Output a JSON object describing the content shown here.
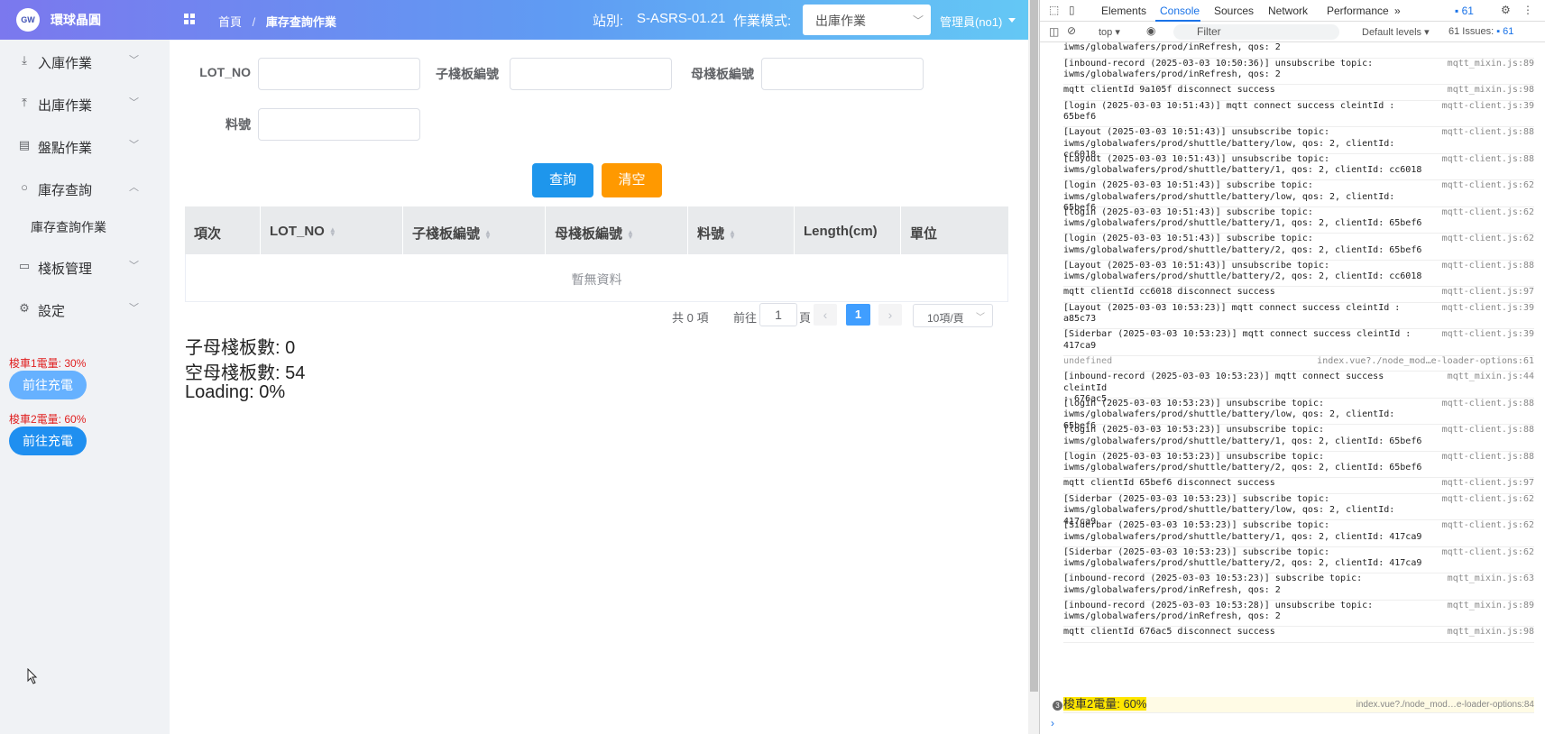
{
  "header": {
    "logo_text": "GW",
    "brand": "環球晶圓",
    "breadcrumb_home": "首頁",
    "breadcrumb_sep": "/",
    "breadcrumb_current": "庫存查詢作業",
    "station_label": "站別:",
    "station_value": "S-ASRS-01.21",
    "mode_label": "作業模式:",
    "mode_value": "出庫作業",
    "user": "管理員(no1)"
  },
  "sidebar": {
    "items": [
      {
        "label": "入庫作業",
        "icon": "download-icon"
      },
      {
        "label": "出庫作業",
        "icon": "upload-icon"
      },
      {
        "label": "盤點作業",
        "icon": "document-icon"
      },
      {
        "label": "庫存查詢",
        "icon": "search-icon"
      },
      {
        "label": "棧板管理",
        "icon": "card-icon"
      },
      {
        "label": "設定",
        "icon": "gear-icon"
      }
    ],
    "sub_item": "庫存查詢作業",
    "battery1": "梭車1電量: 30%",
    "battery2": "梭車2電量: 60%",
    "charge_button": "前往充電"
  },
  "form": {
    "lot_no": "LOT_NO",
    "child_pallet": "子棧板編號",
    "parent_pallet": "母棧板編號",
    "part_no": "料號",
    "query_button": "查詢",
    "clear_button": "清空"
  },
  "table": {
    "columns": [
      "項次",
      "LOT_NO",
      "子棧板編號",
      "母棧板編號",
      "料號",
      "Length(cm)",
      "單位"
    ],
    "empty_text": "暫無資料"
  },
  "pagination": {
    "total": "共 0 項",
    "goto_label": "前往",
    "goto_value": "1",
    "page_unit": "頁",
    "current_page": "1",
    "page_size": "10項/頁"
  },
  "stats": {
    "child_parent": "子母棧板數: 0",
    "empty_parent": "空母棧板數: 54",
    "loading": "Loading: 0%"
  },
  "devtools": {
    "tabs": [
      "Elements",
      "Console",
      "Sources",
      "Network",
      "Performance"
    ],
    "more": "»",
    "issue_count": "61",
    "context": "top",
    "filter_placeholder": "Filter",
    "levels": "Default levels",
    "issues": "61 Issues:",
    "issues_count2": "61",
    "logs": [
      {
        "msg": "iwms/globalwafers/prod/inRefresh, qos: 2",
        "src": ""
      },
      {
        "msg": "[inbound-record (2025-03-03 10:50:36)] unsubscribe topic:\niwms/globalwafers/prod/inRefresh, qos: 2",
        "src": "mqtt_mixin.js:89"
      },
      {
        "msg": "mqtt clientId 9a105f disconnect success",
        "src": "mqtt_mixin.js:98"
      },
      {
        "msg": "[login (2025-03-03 10:51:43)] mqtt connect success cleintId :\n65bef6",
        "src": "mqtt-client.js:39"
      },
      {
        "msg": "[Layout (2025-03-03 10:51:43)] unsubscribe topic:\niwms/globalwafers/prod/shuttle/battery/low, qos: 2, clientId: cc6018",
        "src": "mqtt-client.js:88"
      },
      {
        "msg": "[Layout (2025-03-03 10:51:43)] unsubscribe topic:\niwms/globalwafers/prod/shuttle/battery/1, qos: 2, clientId: cc6018",
        "src": "mqtt-client.js:88"
      },
      {
        "msg": "[login (2025-03-03 10:51:43)] subscribe topic:\niwms/globalwafers/prod/shuttle/battery/low, qos: 2, clientId: 65bef6",
        "src": "mqtt-client.js:62"
      },
      {
        "msg": "[login (2025-03-03 10:51:43)] subscribe topic:\niwms/globalwafers/prod/shuttle/battery/1, qos: 2, clientId: 65bef6",
        "src": "mqtt-client.js:62"
      },
      {
        "msg": "[login (2025-03-03 10:51:43)] subscribe topic:\niwms/globalwafers/prod/shuttle/battery/2, qos: 2, clientId: 65bef6",
        "src": "mqtt-client.js:62"
      },
      {
        "msg": "[Layout (2025-03-03 10:51:43)] unsubscribe topic:\niwms/globalwafers/prod/shuttle/battery/2, qos: 2, clientId: cc6018",
        "src": "mqtt-client.js:88"
      },
      {
        "msg": "mqtt clientId cc6018 disconnect success",
        "src": "mqtt-client.js:97"
      },
      {
        "msg": "[Layout (2025-03-03 10:53:23)] mqtt connect success cleintId :\na85c73",
        "src": "mqtt-client.js:39"
      },
      {
        "msg": "[Siderbar (2025-03-03 10:53:23)] mqtt connect success cleintId :\n417ca9",
        "src": "mqtt-client.js:39"
      },
      {
        "msg": "undefined",
        "src": "index.vue?./node_mod…e-loader-options:61",
        "muted": true
      },
      {
        "msg": "[inbound-record (2025-03-03 10:53:23)] mqtt connect success cleintId\n: 676ac5",
        "src": "mqtt_mixin.js:44"
      },
      {
        "msg": "[login (2025-03-03 10:53:23)] unsubscribe topic:\niwms/globalwafers/prod/shuttle/battery/low, qos: 2, clientId: 65bef6",
        "src": "mqtt-client.js:88"
      },
      {
        "msg": "[login (2025-03-03 10:53:23)] unsubscribe topic:\niwms/globalwafers/prod/shuttle/battery/1, qos: 2, clientId: 65bef6",
        "src": "mqtt-client.js:88"
      },
      {
        "msg": "[login (2025-03-03 10:53:23)] unsubscribe topic:\niwms/globalwafers/prod/shuttle/battery/2, qos: 2, clientId: 65bef6",
        "src": "mqtt-client.js:88"
      },
      {
        "msg": "mqtt clientId 65bef6 disconnect success",
        "src": "mqtt-client.js:97"
      },
      {
        "msg": "[Siderbar (2025-03-03 10:53:23)] subscribe topic:\niwms/globalwafers/prod/shuttle/battery/low, qos: 2, clientId: 417ca9",
        "src": "mqtt-client.js:62"
      },
      {
        "msg": "[Siderbar (2025-03-03 10:53:23)] subscribe topic:\niwms/globalwafers/prod/shuttle/battery/1, qos: 2, clientId: 417ca9",
        "src": "mqtt-client.js:62"
      },
      {
        "msg": "[Siderbar (2025-03-03 10:53:23)] subscribe topic:\niwms/globalwafers/prod/shuttle/battery/2, qos: 2, clientId: 417ca9",
        "src": "mqtt-client.js:62"
      },
      {
        "msg": "[inbound-record (2025-03-03 10:53:23)] subscribe topic:\niwms/globalwafers/prod/inRefresh, qos: 2",
        "src": "mqtt_mixin.js:63"
      },
      {
        "msg": "[inbound-record (2025-03-03 10:53:28)] unsubscribe topic:\niwms/globalwafers/prod/inRefresh, qos: 2",
        "src": "mqtt_mixin.js:89"
      },
      {
        "msg": "mqtt clientId 676ac5 disconnect success",
        "src": "mqtt_mixin.js:98"
      }
    ],
    "last_badge": "3",
    "last_msg": "梭車2電量: 60%",
    "last_src": "index.vue?./node_mod…e-loader-options:84",
    "prompt": "›"
  },
  "colors": {
    "header_gradient_start": "#7b78ee",
    "header_gradient_end": "#64c8f5",
    "primary": "#1e96ec",
    "warning": "#ff9900",
    "danger_text": "#e02020"
  }
}
